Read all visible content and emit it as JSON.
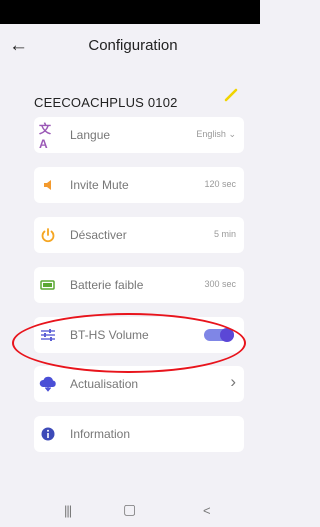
{
  "header": {
    "title": "Configuration",
    "back_icon": "arrow-left-icon"
  },
  "device": {
    "name": "CEECOACHPLUS 0102",
    "edit_icon": "pencil-icon",
    "edit_color": "#f0d400"
  },
  "settings": [
    {
      "label": "Langue",
      "value": "English",
      "icon": "translate-icon",
      "icon_color": "#9b59b6",
      "control": "dropdown"
    },
    {
      "label": "Invite Mute",
      "value": "120 sec",
      "icon": "speaker-icon",
      "icon_color": "#f39a2e",
      "control": "value"
    },
    {
      "label": "Désactiver",
      "value": "5 min",
      "icon": "power-icon",
      "icon_color": "#f5a623",
      "control": "value"
    },
    {
      "label": "Batterie faible",
      "value": "300 sec",
      "icon": "battery-icon",
      "icon_color": "#5aa832",
      "control": "value"
    },
    {
      "label": "BT-HS Volume",
      "icon": "sliders-icon",
      "icon_color": "#5b5fd6",
      "control": "toggle",
      "toggle_on": true,
      "toggle_color": "#6c63e0"
    },
    {
      "label": "Actualisation",
      "icon": "cloud-download-icon",
      "icon_color": "#4a4fd6",
      "control": "chevron"
    },
    {
      "label": "Information",
      "icon": "info-icon",
      "icon_color": "#3d4ab8",
      "control": "none"
    }
  ],
  "annotation": {
    "color": "#e8141c"
  },
  "nav": {
    "recents": "|||",
    "home": "▢",
    "back": "<"
  }
}
